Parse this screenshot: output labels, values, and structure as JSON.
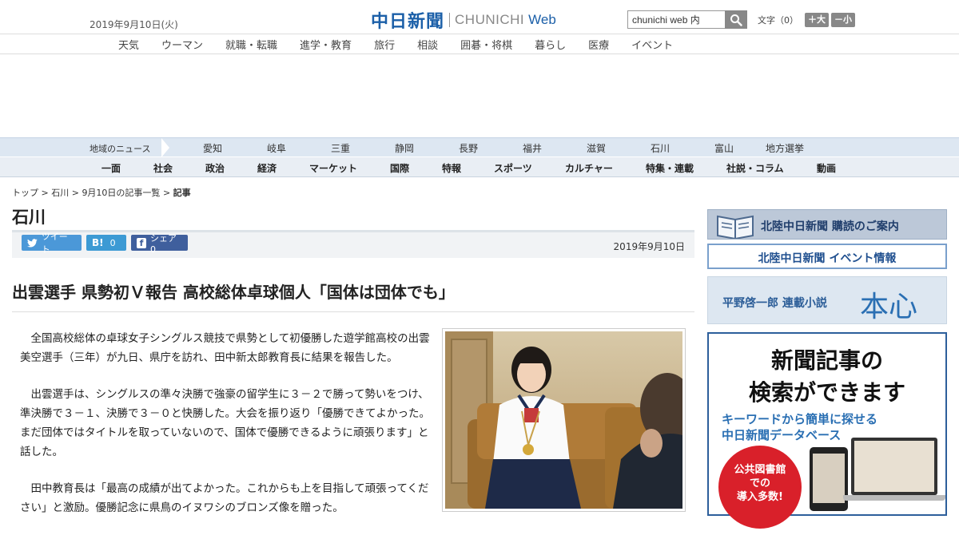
{
  "header": {
    "date": "2019年9月10日(火)",
    "logo_jp": "中日新聞",
    "logo_en": "CHUNICHI",
    "logo_web": "Web",
    "search_value": "chunichi web 内",
    "fontsize_label": "文字（0）",
    "fontsize_up": "＋大",
    "fontsize_down": "－小"
  },
  "category_nav": [
    "天気",
    "ウーマン",
    "就職・転職",
    "進学・教育",
    "旅行",
    "相談",
    "囲碁・将棋",
    "暮らし",
    "医療",
    "イベント"
  ],
  "region_nav": {
    "label": "地域のニュース",
    "items": [
      "愛知",
      "岐阜",
      "三重",
      "静岡",
      "長野",
      "福井",
      "滋賀",
      "石川",
      "富山",
      "地方選挙"
    ]
  },
  "section_nav": [
    "一面",
    "社会",
    "政治",
    "経済",
    "マーケット",
    "国際",
    "特報",
    "スポーツ",
    "カルチャー",
    "特集・連載",
    "社説・コラム",
    "動画"
  ],
  "breadcrumb": {
    "top": "トップ",
    "sep": ">",
    "region": "石川",
    "list": "9月10日の記事一覧",
    "current": "記事"
  },
  "section_title": "石川",
  "share": {
    "tweet": "ツイート",
    "hatena": "0",
    "facebook": "シェア 0",
    "date": "2019年9月10日"
  },
  "article": {
    "headline": "出雲選手 県勢初Ｖ報告 高校総体卓球個人「国体は団体でも」",
    "paragraphs": [
      "全国高校総体の卓球女子シングルス競技で県勢として初優勝した遊学館高校の出雲美空選手（三年）が九日、県庁を訪れ、田中新太郎教育長に結果を報告した。",
      "出雲選手は、シングルスの準々決勝で強豪の留学生に３－２で勝って勢いをつけ、準決勝で３－１、決勝で３－０と快勝した。大会を振り返り「優勝できてよかった。まだ団体ではタイトルを取っていないので、国体で優勝できるように頑張ります」と話した。",
      "田中教育長は「最高の成績が出てよかった。これからも上を目指して頑張ってください」と激励。優勝記念に県鳥のイヌワシのブロンズ像を贈った。"
    ]
  },
  "sidebar": {
    "ad1": "北陸中日新聞 購読のご案内",
    "ad2": "北陸中日新聞 イベント情報",
    "ad3_small": "平野啓一郎 連載小説",
    "ad3_big": "本心",
    "ad4_line1": "新聞記事の",
    "ad4_line2": "検索ができます",
    "ad4_line3": "キーワードから簡単に探せる",
    "ad4_line4": "中日新聞データベース",
    "ad4_badge1": "公共図書館",
    "ad4_badge2": "での",
    "ad4_badge3": "導入多数!"
  },
  "colors": {
    "brand_blue": "#1b5fa8",
    "region_bg": "#dde7f2",
    "section_bg": "#e9eef4",
    "twitter": "#4b98d8",
    "hatena": "#3c9ad4",
    "facebook": "#3f5f9d"
  }
}
